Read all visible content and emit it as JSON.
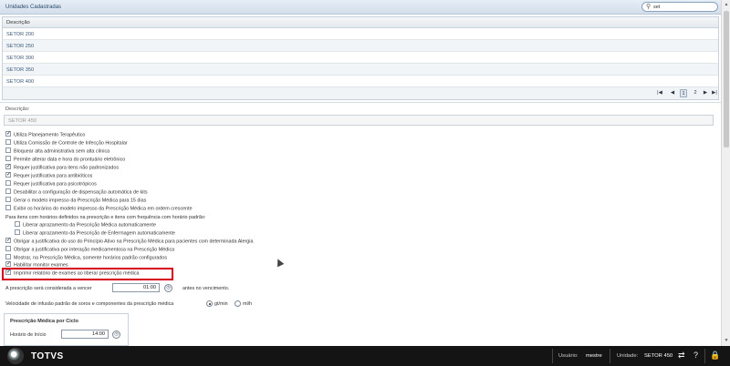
{
  "header": {
    "title": "Unidades Cadastradas"
  },
  "search": {
    "value": "set"
  },
  "grid": {
    "column": "Descrição",
    "rows": [
      "SETOR 200",
      "SETOR 250",
      "SETOR 300",
      "SETOR 350",
      "SETOR 400"
    ]
  },
  "pager": {
    "pages": [
      "1",
      "2"
    ]
  },
  "form": {
    "description_label": "Descrição:",
    "description_value": "SETOR 450",
    "options": [
      {
        "label": "Utiliza Planejamento Terapêutico",
        "checked": true
      },
      {
        "label": "Utiliza Comissão de Controle de Infecção Hospitalar",
        "checked": false
      },
      {
        "label": "Bloquear alta administrativa sem alta clínica",
        "checked": false
      },
      {
        "label": "Permite alterar data e hora do prontuário eletrônico",
        "checked": false
      },
      {
        "label": "Requer justificativa para itens não padronizados",
        "checked": true
      },
      {
        "label": "Requer justificativa para antibióticos",
        "checked": true
      },
      {
        "label": "Requer justificativa para psicotrópicos",
        "checked": false
      },
      {
        "label": "Desabilitar a configuração de dispensação automática de kits",
        "checked": false
      },
      {
        "label": "Gerar o modelo impresso da Prescrição Médica para 15 dias",
        "checked": false
      },
      {
        "label": "Exibir os horários do modelo impresso da Prescrição Médica em ordem crescente",
        "checked": false
      }
    ],
    "freq_text": "Para itens com horários definidos na prescrição e itens com frequência com horário padrão:",
    "sub_options": [
      {
        "label": "Liberar aprazamento da Prescrição Médica automaticamente",
        "checked": false
      },
      {
        "label": "Liberar aprazamento da Prescrição de Enfermagem automaticamente",
        "checked": false
      }
    ],
    "options2": [
      {
        "label": "Obrigar a justificativa do uso do Princípio Ativo na Prescrição Médica para pacientes com determinada Alergia",
        "checked": true
      },
      {
        "label": "Obrigar a justificativa por interação medicamentosa na Prescrição Médica",
        "checked": false
      },
      {
        "label": "Mostrar, na Prescrição Médica, somente horários padrão configurados",
        "checked": false
      },
      {
        "label": "Habilitar monitor exames",
        "checked": true
      }
    ],
    "highlight_option": {
      "label": "Imprimir relatório de exames ao liberar prescrição médica",
      "checked": true
    },
    "expire_prefix": "A prescrição será considerada a vencer",
    "expire_time": "01:00",
    "expire_suffix": "antes no vencimento.",
    "infusion_text": "Velocidade de infusão padrão de soros e componentes da prescrição médica",
    "infusion_opt1": "gt/min",
    "infusion_opt2": "ml/h",
    "cycle_title": "Prescrição Médica por Ciclo",
    "start_label": "Horário de Início",
    "start_time": "14:00"
  },
  "footer": {
    "brand": "TOTVS",
    "user_label": "Usuário:",
    "user_value": "mestre",
    "unit_label": "Unidade:",
    "unit_value": "SETOR 450"
  }
}
